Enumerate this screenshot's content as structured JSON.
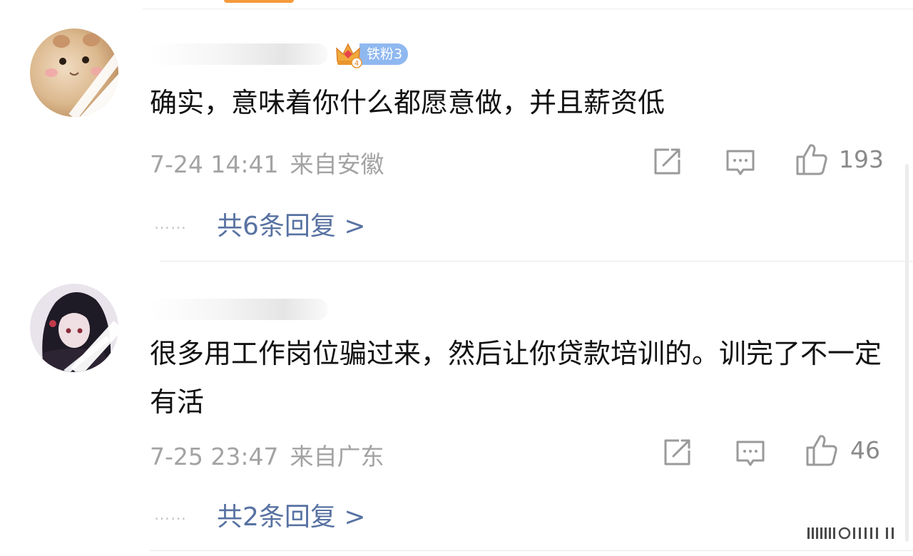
{
  "comments": [
    {
      "fan_badge": {
        "level": "4",
        "label": "铁粉3"
      },
      "text": "确实，意味着你什么都愿意做，并且薪资低",
      "time": "7-24 14:41",
      "location": "来自安徽",
      "likes": "193",
      "replies_link": "共6条回复 >",
      "dots": "……"
    },
    {
      "text": "很多用工作岗位骗过来，然后让你贷款培训的。训完了不一定有活",
      "time": "7-25 23:47",
      "location": "来自广东",
      "likes": "46",
      "replies_link": "共2条回复 >",
      "dots": "……"
    }
  ],
  "colors": {
    "link": "#5872a2",
    "meta": "#a3a3a3",
    "fan_badge": "#8fb8f0",
    "crown": "#f2a93b",
    "top_chip": "#f59a3c"
  },
  "icons": [
    "crown-icon",
    "share-icon",
    "comment-icon",
    "like-icon"
  ]
}
